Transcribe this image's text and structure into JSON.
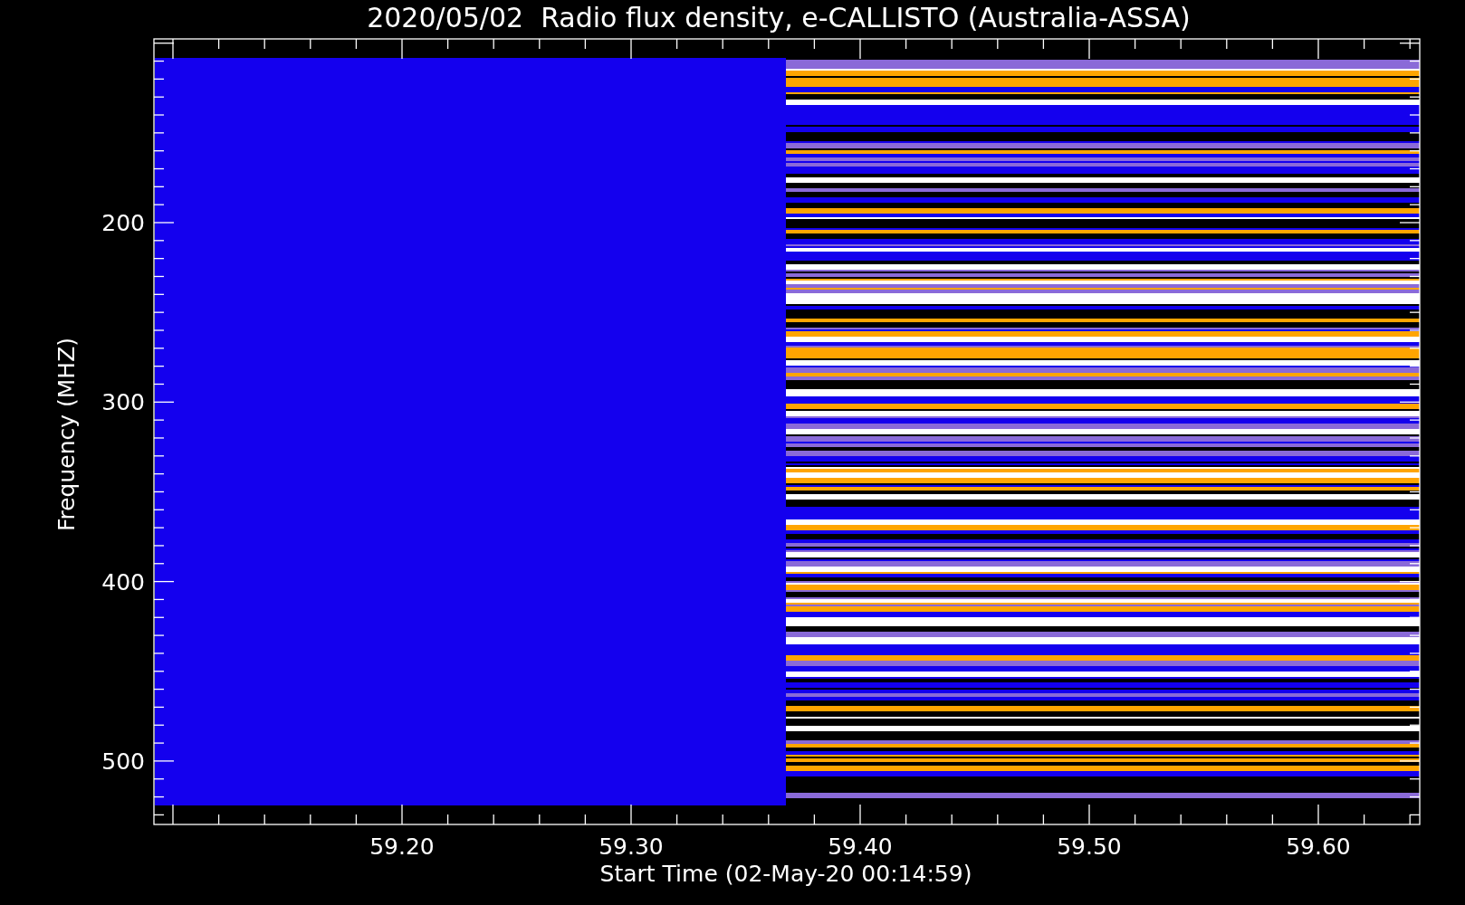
{
  "title": "2020/05/02  Radio flux density, e-CALLISTO (Australia-ASSA)",
  "y_axis": {
    "label": "Frequency (MHZ)",
    "ticks": [
      "200",
      "300",
      "400",
      "500"
    ]
  },
  "x_axis": {
    "label": "Start Time (02-May-20 00:14:59)",
    "ticks": [
      "59.20",
      "59.30",
      "59.40",
      "59.50",
      "59.60"
    ]
  }
}
